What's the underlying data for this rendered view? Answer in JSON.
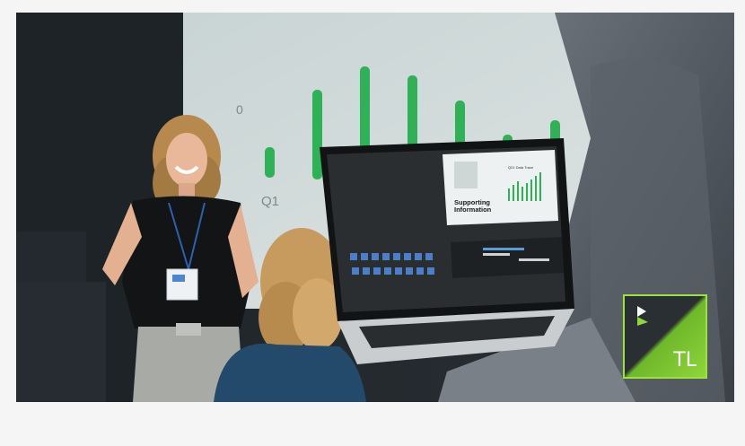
{
  "hero": {
    "alt": "Presenter showing a chart on a projection screen while an audience member holds a laptop running an editing application"
  },
  "chart_screen": {
    "axis_value": "0",
    "category": "Q1",
    "bar_color": "#2fb257"
  },
  "laptop_screen": {
    "slide_title": "Supporting Information",
    "slide_caption": "Q01 Data Trace"
  },
  "logo": {
    "text": "TL",
    "accent": "#8fd63a"
  }
}
